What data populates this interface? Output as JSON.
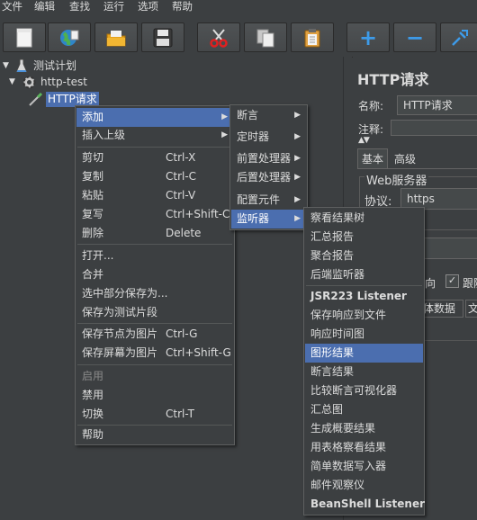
{
  "menubar": {
    "items": [
      "文件",
      "编辑",
      "查找",
      "运行",
      "选项",
      "帮助"
    ]
  },
  "toolbar": {
    "buttons": [
      "new-icon",
      "templates-icon",
      "open-icon",
      "save-icon",
      "cut-icon",
      "copy-icon",
      "paste-icon",
      "expand-icon",
      "collapse-icon",
      "toggle-icon"
    ],
    "plus": "+",
    "minus": "−"
  },
  "tree": {
    "test_plan": "测试计划",
    "thread_group": "http-test",
    "sampler": "HTTP请求"
  },
  "right_panel": {
    "title": "HTTP请求",
    "name_label": "名称:",
    "name_value": "HTTP请求",
    "comment_label": "注释:",
    "tab_basic": "基本",
    "tab_advanced": "高级",
    "web_server": "Web服务器",
    "protocol_label": "协议:",
    "protocol_value": "https",
    "partial_text_1": "向",
    "partial_text_2": "跟随",
    "partial_tab_body": "体数据",
    "partial_tab_file": "文"
  },
  "context_menu": {
    "add": "添加",
    "insert_parent": "插入上级",
    "cut": "剪切",
    "cut_sc": "Ctrl-X",
    "copy": "复制",
    "copy_sc": "Ctrl-C",
    "paste": "粘贴",
    "paste_sc": "Ctrl-V",
    "duplicate": "复写",
    "duplicate_sc": "Ctrl+Shift-C",
    "delete": "删除",
    "delete_sc": "Delete",
    "open": "打开...",
    "merge": "合并",
    "save_selection": "选中部分保存为...",
    "save_fragment": "保存为测试片段",
    "save_node_image": "保存节点为图片",
    "save_node_image_sc": "Ctrl-G",
    "save_screen_image": "保存屏幕为图片",
    "save_screen_image_sc": "Ctrl+Shift-G",
    "enable": "启用",
    "disable": "禁用",
    "toggle": "切换",
    "toggle_sc": "Ctrl-T",
    "help": "帮助"
  },
  "add_submenu": {
    "assertion": "断言",
    "timer": "定时器",
    "pre_processor": "前置处理器",
    "post_processor": "后置处理器",
    "config": "配置元件",
    "listener": "监听器"
  },
  "listener_submenu": {
    "items": [
      "察看结果树",
      "汇总报告",
      "聚合报告",
      "后端监听器",
      "JSR223 Listener",
      "保存响应到文件",
      "响应时间图",
      "图形结果",
      "断言结果",
      "比较断言可视化器",
      "汇总图",
      "生成概要结果",
      "用表格察看结果",
      "简单数据写入器",
      "邮件观察仪",
      "BeanShell Listener"
    ]
  },
  "colors": {
    "background": "#3c3f41",
    "selection": "#4b6eaf",
    "text": "#dcdcdc"
  }
}
